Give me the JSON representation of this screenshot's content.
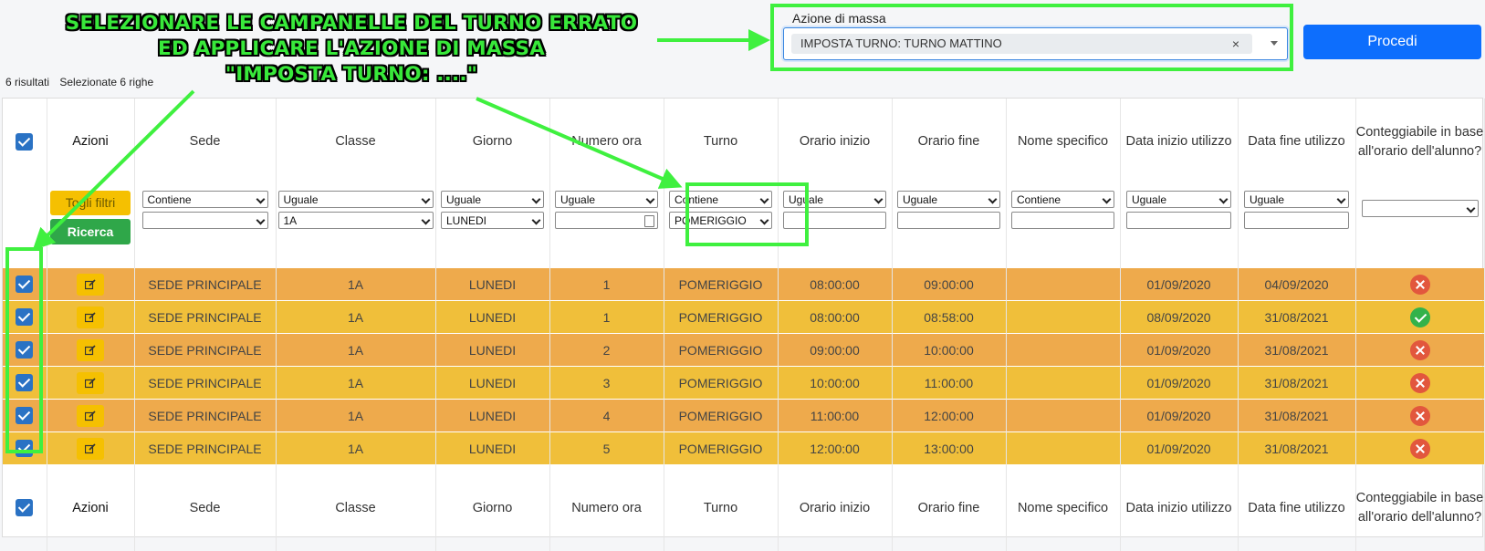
{
  "annotation": {
    "lines": [
      "SELEZIONARE LE CAMPANELLE DEL TURNO ERRATO",
      "ED APPLICARE L'AZIONE DI MASSA",
      "\"IMPOSTA TURNO: ....\""
    ],
    "color": "#38e83a"
  },
  "results": {
    "count": "6 risultati",
    "selected": "Selezionate 6 righe"
  },
  "mass_action": {
    "label": "Azione di massa",
    "value": "IMPOSTA TURNO: TURNO MATTINO",
    "clear": "×",
    "button": "Procedi"
  },
  "columns": [
    "Azioni",
    "Sede",
    "Classe",
    "Giorno",
    "Numero ora",
    "Turno",
    "Orario inizio",
    "Orario fine",
    "Nome specifico",
    "Data inizio utilizzo",
    "Data fine utilizzo",
    "Conteggiabile in base all'orario dell'alunno?"
  ],
  "filters": {
    "togli": "Togli filtri",
    "ricerca": "Ricerca",
    "sede": {
      "op": "Contiene",
      "val": ""
    },
    "classe": {
      "op": "Uguale",
      "val": "1A"
    },
    "giorno": {
      "op": "Uguale",
      "val": "LUNEDI"
    },
    "numero": {
      "op": "Uguale",
      "val": ""
    },
    "turno": {
      "op": "Contiene",
      "val": "POMERIGGIO"
    },
    "inizio": {
      "op": "Uguale",
      "val": ""
    },
    "fine": {
      "op": "Uguale",
      "val": ""
    },
    "nome": {
      "op": "Contiene",
      "val": ""
    },
    "dinizio": {
      "op": "Uguale",
      "val": ""
    },
    "dfine": {
      "op": "Uguale",
      "val": ""
    }
  },
  "rows": [
    {
      "sede": "SEDE PRINCIPALE",
      "classe": "1A",
      "giorno": "LUNEDI",
      "numero": "1",
      "turno": "POMERIGGIO",
      "inizio": "08:00:00",
      "fine": "09:00:00",
      "nome": "",
      "dinizio": "01/09/2020",
      "dfine": "04/09/2020",
      "conteggiabile": "no",
      "color": "orange"
    },
    {
      "sede": "SEDE PRINCIPALE",
      "classe": "1A",
      "giorno": "LUNEDI",
      "numero": "1",
      "turno": "POMERIGGIO",
      "inizio": "08:00:00",
      "fine": "08:58:00",
      "nome": "",
      "dinizio": "08/09/2020",
      "dfine": "31/08/2021",
      "conteggiabile": "yes",
      "color": "yellow"
    },
    {
      "sede": "SEDE PRINCIPALE",
      "classe": "1A",
      "giorno": "LUNEDI",
      "numero": "2",
      "turno": "POMERIGGIO",
      "inizio": "09:00:00",
      "fine": "10:00:00",
      "nome": "",
      "dinizio": "01/09/2020",
      "dfine": "31/08/2021",
      "conteggiabile": "no",
      "color": "orange"
    },
    {
      "sede": "SEDE PRINCIPALE",
      "classe": "1A",
      "giorno": "LUNEDI",
      "numero": "3",
      "turno": "POMERIGGIO",
      "inizio": "10:00:00",
      "fine": "11:00:00",
      "nome": "",
      "dinizio": "01/09/2020",
      "dfine": "31/08/2021",
      "conteggiabile": "no",
      "color": "yellow"
    },
    {
      "sede": "SEDE PRINCIPALE",
      "classe": "1A",
      "giorno": "LUNEDI",
      "numero": "4",
      "turno": "POMERIGGIO",
      "inizio": "11:00:00",
      "fine": "12:00:00",
      "nome": "",
      "dinizio": "01/09/2020",
      "dfine": "31/08/2021",
      "conteggiabile": "no",
      "color": "orange"
    },
    {
      "sede": "SEDE PRINCIPALE",
      "classe": "1A",
      "giorno": "LUNEDI",
      "numero": "5",
      "turno": "POMERIGGIO",
      "inizio": "12:00:00",
      "fine": "13:00:00",
      "nome": "",
      "dinizio": "01/09/2020",
      "dfine": "31/08/2021",
      "conteggiabile": "no",
      "color": "yellow"
    }
  ],
  "colors": {
    "orange_row": "#eeaa4c",
    "yellow_row": "#f0bf3a",
    "primary": "#0d6efd",
    "success": "#2fa749",
    "warning": "#f5c001",
    "highlight": "#3ff03f"
  },
  "icons": {
    "edit": "edit-icon",
    "no": "x-circle-icon",
    "yes": "check-circle-icon",
    "checkbox": "checkbox-icon"
  }
}
